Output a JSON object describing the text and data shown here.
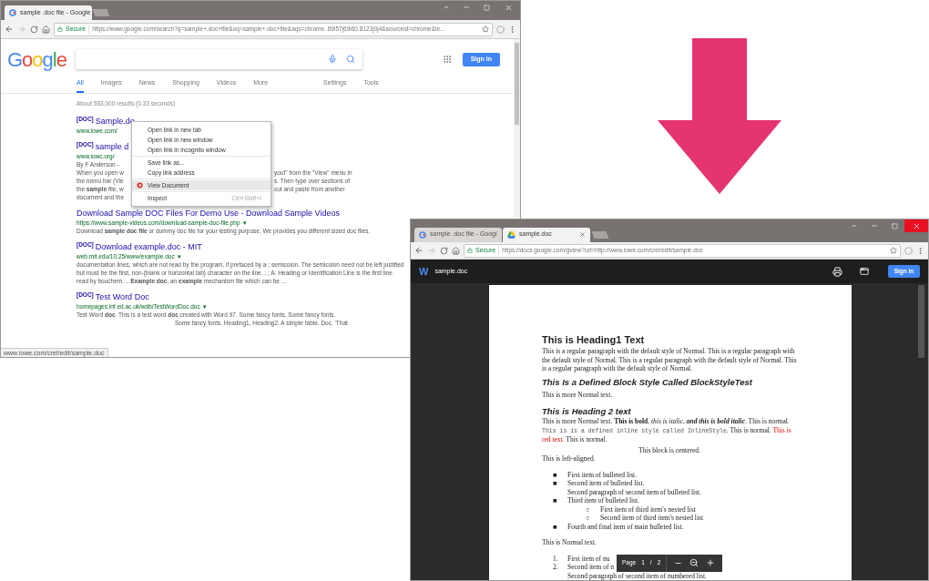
{
  "search_window": {
    "tabs": [
      {
        "label": "sample .doc file - Google",
        "selected": true
      }
    ],
    "address": {
      "secure": "Secure",
      "url": "https://www.google.com/search?q=sample+.doc+file&oq=sample+.doc+file&aqs=chrome..69i57j69i60.8123j0j4&sourceid=chrome&ie..."
    },
    "logo": "Google",
    "sign_in": "Sign in",
    "nav": [
      {
        "label": "All",
        "selected": true
      },
      {
        "label": "Images",
        "selected": false
      },
      {
        "label": "News",
        "selected": false
      },
      {
        "label": "Shopping",
        "selected": false
      },
      {
        "label": "Videos",
        "selected": false
      },
      {
        "label": "More",
        "selected": false
      }
    ],
    "tools": [
      "Settings",
      "Tools"
    ],
    "result_stats": "About 583,000 results (0.33 seconds)",
    "results": [
      {
        "badge": "[DOC]",
        "title": "Sample.do",
        "url": "www.iowe.com/"
      },
      {
        "badge": "[DOC]",
        "title": "sample d",
        "url": "www.iowc.org/",
        "snippet_lines": [
          {
            "left": "By F Anderson - "
          },
          {
            "left": "When you open w",
            "right": "yout\" from the \"View\" menu in"
          },
          {
            "left": "the menu bar (Vie",
            "right": "s. Then type over sections of"
          },
          {
            "left": "the **sample** file, w",
            "right": "cut and paste from another"
          },
          {
            "left": "document and the"
          }
        ]
      },
      {
        "title": "Download Sample DOC Files For Demo Use - Download Sample Videos",
        "url": "https://www.sample-videos.com/download-sample-doc-file.php",
        "url_menu": "▾",
        "snippet": "Download **sample doc file** or dummy doc file for your testing purpose. We provides you different sized doc files."
      },
      {
        "badge": "[DOC]",
        "title": "Download example.doc - MIT",
        "url": "web.mit.edu/10.25/www/example.doc",
        "url_menu": "▾",
        "snippet": "documentation lines, which are not read by the program, if prefaced by a ; semicolon. The semicolon need not be left justified but must be the first, non-{blank or horizontal tab} character on the line. ; ; A: Heading or Identification Line is the first line read by bouchem. .. **Example doc**, an **example** mechanism file which can be ..."
      },
      {
        "badge": "[DOC]",
        "title": "Test Word Doc",
        "url": "homepages.inf.ed.ac.uk/wdb/TestWordDoc.doc",
        "url_menu": "▾",
        "snippet": "Test Word **doc**. This is a test word **doc** created with Word 97. Some fancy fonts. Some fancy fonts.",
        "snippet_end": "Some fancy fonts. Heading1, Heading2. A simple table. Doc. 'That"
      }
    ],
    "context_menu": [
      [
        {
          "label": "Open link in new tab",
          "selected": false
        },
        {
          "label": "Open link in new window",
          "selected": false
        },
        {
          "label": "Open link in incognito window",
          "selected": false
        }
      ],
      [
        {
          "label": "Save link as...",
          "selected": false
        },
        {
          "label": "Copy link address",
          "selected": false
        }
      ],
      [
        {
          "label": "View Document",
          "selected": true
        }
      ],
      [
        {
          "label": "Inspect",
          "selected": false,
          "shortcut": "Ctrl+Shift+I"
        }
      ]
    ],
    "status_url": "www.iowe.com/crel/edit/sample.doc"
  },
  "viewer_window": {
    "tabs": [
      {
        "label": "sample .doc file - Googl",
        "selected": false
      },
      {
        "label": "sample.doc",
        "selected": true
      }
    ],
    "address": {
      "secure": "Secure",
      "url": "https://docs.google.com/gview?url=http://www.iowe.com/crel/edit/sample.doc"
    },
    "app_letter": "W",
    "file_name": "sample.doc",
    "sign_in": "Sign in",
    "document": [
      {
        "kind": "heading1",
        "text": "This is Heading1 Text"
      },
      {
        "kind": "paragraph",
        "text": "This is a regular paragraph with the default style of Normal. This is a regular paragraph with the default style of Normal. This is a regular paragraph with the default style of Normal. This is a regular paragraph with the default style of Normal."
      },
      {
        "kind": "block_style",
        "text": "This Is a Defined Block Style Called BlockStyleTest"
      },
      {
        "kind": "paragraph",
        "text": "This is more Normal text."
      },
      {
        "kind": "heading2",
        "text": "This is Heading 2 text"
      },
      {
        "kind": "mixed_paragraph",
        "segments": [
          {
            "kind": "plain",
            "text": "This is more Normal text. **This is bold**, *this is italic*, "
          },
          {
            "kind": "bold_italic",
            "text": "and this is bold italic"
          },
          {
            "kind": "plain",
            "text": ". This is normal. "
          },
          {
            "kind": "code",
            "text": "This is is a defined inline style called InlineStyle"
          },
          {
            "kind": "plain",
            "text": ". This is normal. "
          },
          {
            "kind": "red",
            "text": "This is red text."
          },
          {
            "kind": "plain",
            "text": " This is normal."
          }
        ]
      },
      {
        "kind": "centered",
        "text": "This block is centered."
      },
      {
        "kind": "paragraph",
        "text": "This is left-aligned."
      },
      {
        "kind": "list",
        "items": [
          {
            "marker": "■",
            "text": "First item of bulleted list."
          },
          {
            "marker": "■",
            "text": "Second item of bulleted list.",
            "continuation": "Second paragraph of second item of bulleted list."
          },
          {
            "marker": "■",
            "text": "Third item of bulleted list.",
            "children": [
              {
                "marker": "○",
                "text": "First item of third item's nested list"
              },
              {
                "marker": "○",
                "text": "Second item of third item's nested list"
              }
            ]
          },
          {
            "marker": "■",
            "text": "Fourth and final item of main bulleted list."
          }
        ]
      },
      {
        "kind": "paragraph",
        "text": "This is Normal text."
      },
      {
        "kind": "numbered_list",
        "items": [
          {
            "marker": "1.",
            "text": "First item of nu"
          },
          {
            "marker": "2.",
            "text": "Second item of n",
            "continuation": "Second paragraph of second item of numbered list."
          }
        ]
      }
    ],
    "page_toolbar": {
      "label": "Page",
      "current": "1",
      "separator": "/",
      "total": "2"
    }
  }
}
